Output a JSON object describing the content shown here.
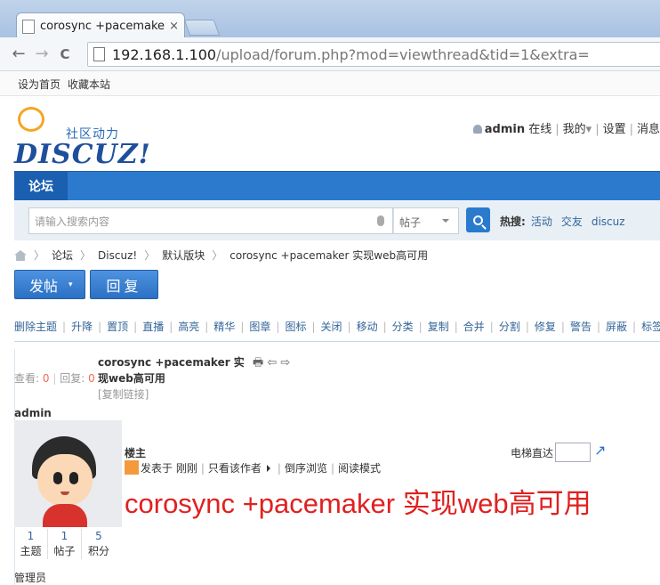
{
  "browser": {
    "tab_title": "corosync +pacemaker",
    "tab_close": "×",
    "url_host": "192.168.1.100",
    "url_rest": "/upload/forum.php?mod=viewthread&tid=1&extra=",
    "back": "←",
    "forward": "→",
    "reload": "C"
  },
  "site_topbar": {
    "set_home": "设为首页",
    "bookmark": "收藏本站"
  },
  "header": {
    "logo_tagline": "社区动力",
    "logo_brand": "DISCUZ!",
    "username": "admin",
    "online": "在线",
    "my": "我的",
    "my_caret": "▾",
    "settings": "设置",
    "messages": "消息"
  },
  "nav": {
    "active": "论坛"
  },
  "search": {
    "placeholder": "请输入搜索内容",
    "type": "帖子",
    "hot_label": "热搜:",
    "hot_keywords": [
      "活动",
      "交友",
      "discuz"
    ]
  },
  "breadcrumb": {
    "items": [
      "论坛",
      "Discuz!",
      "默认版块",
      "corosync +pacemaker 实现web高可用"
    ],
    "sep": "〉"
  },
  "actions": {
    "post": "发帖",
    "post_caret": "▾",
    "reply": "回复"
  },
  "moderation": [
    "删除主题",
    "升降",
    "置顶",
    "直播",
    "高亮",
    "精华",
    "图章",
    "图标",
    "关闭",
    "移动",
    "分类",
    "复制",
    "合并",
    "分割",
    "修复",
    "警告",
    "屏蔽",
    "标签"
  ],
  "thread": {
    "views_label": "查看:",
    "views": "0",
    "replies_label": "回复:",
    "replies": "0",
    "title": "corosync +pacemaker 实现web高可用",
    "tools": "🖶 ⇦ ⇨",
    "copy_link": "[复制链接]"
  },
  "author": {
    "name": "admin",
    "stats": [
      {
        "value": "1",
        "label": "主题"
      },
      {
        "value": "1",
        "label": "帖子"
      },
      {
        "value": "5",
        "label": "积分"
      }
    ],
    "role": "管理员"
  },
  "post": {
    "floor": "楼主",
    "posted_at": "发表于 刚刚",
    "only_author": "只看该作者",
    "reverse": "倒序浏览",
    "read_mode": "阅读模式",
    "elevator": "电梯直达",
    "elevator_go": "↗",
    "body": "corosync +pacemaker 实现web高可用"
  }
}
